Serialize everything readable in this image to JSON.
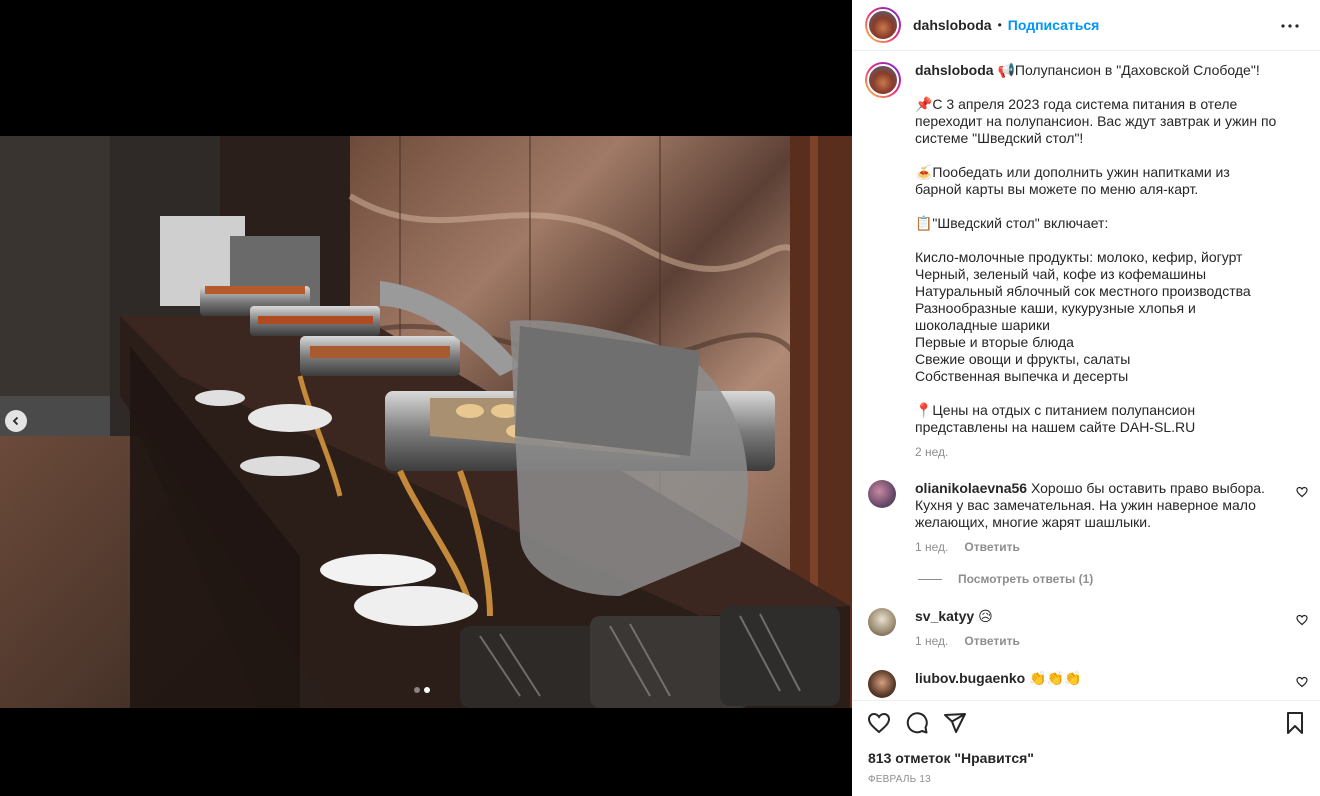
{
  "post": {
    "username": "dahsloboda",
    "separator": "•",
    "follow_label": "Подписаться",
    "caption_intro": "📢Полупансион в \"Даховской Слободе\"!",
    "caption_lines": [
      "📌С 3 апреля 2023 года система питания в отеле переходит на полупансион. Вас ждут завтрак и ужин по системе \"Шведский стол\"!",
      "🍝Пообедать или дополнить ужин напитками из барной карты вы можете по меню аля-карт.",
      "📋\"Шведский стол\" включает:",
      "Кисло-молочные продукты: молоко, кефир, йогурт\nЧерный, зеленый чай, кофе из кофемашины\nНатуральный яблочный сок местного производства\nРазнообразные каши, кукурузные хлопья и шоколадные шарики\nПервые и вторые блюда\nСвежие овощи и фрукты, салаты\nСобственная выпечка и десерты",
      "📍Цены на отдых с питанием полупансион представлены на нашем сайте DAH-SL.RU"
    ],
    "caption_time": "2 нед.",
    "likes": "813 отметок \"Нравится\"",
    "date": "ФЕВРАЛЬ 13"
  },
  "comments": [
    {
      "username": "olianikolaevna56",
      "text": "Хорошо бы оставить право выбора. Кухня у вас замечательная. На ужин наверное мало желающих, многие жарят шашлыки.",
      "time": "1 нед.",
      "reply": "Ответить"
    },
    {
      "username": "sv_katyy",
      "text": "😥",
      "time": "1 нед.",
      "reply": "Ответить"
    },
    {
      "username": "liubov.bugaenko",
      "text": "👏👏👏",
      "time": "",
      "reply": ""
    }
  ],
  "view_replies": "Посмотреть ответы (1)",
  "colors": {
    "accent": "#0095f6",
    "text": "#262626",
    "muted": "#8e8e8e"
  },
  "carousel": {
    "slides": 2,
    "active": 2
  }
}
